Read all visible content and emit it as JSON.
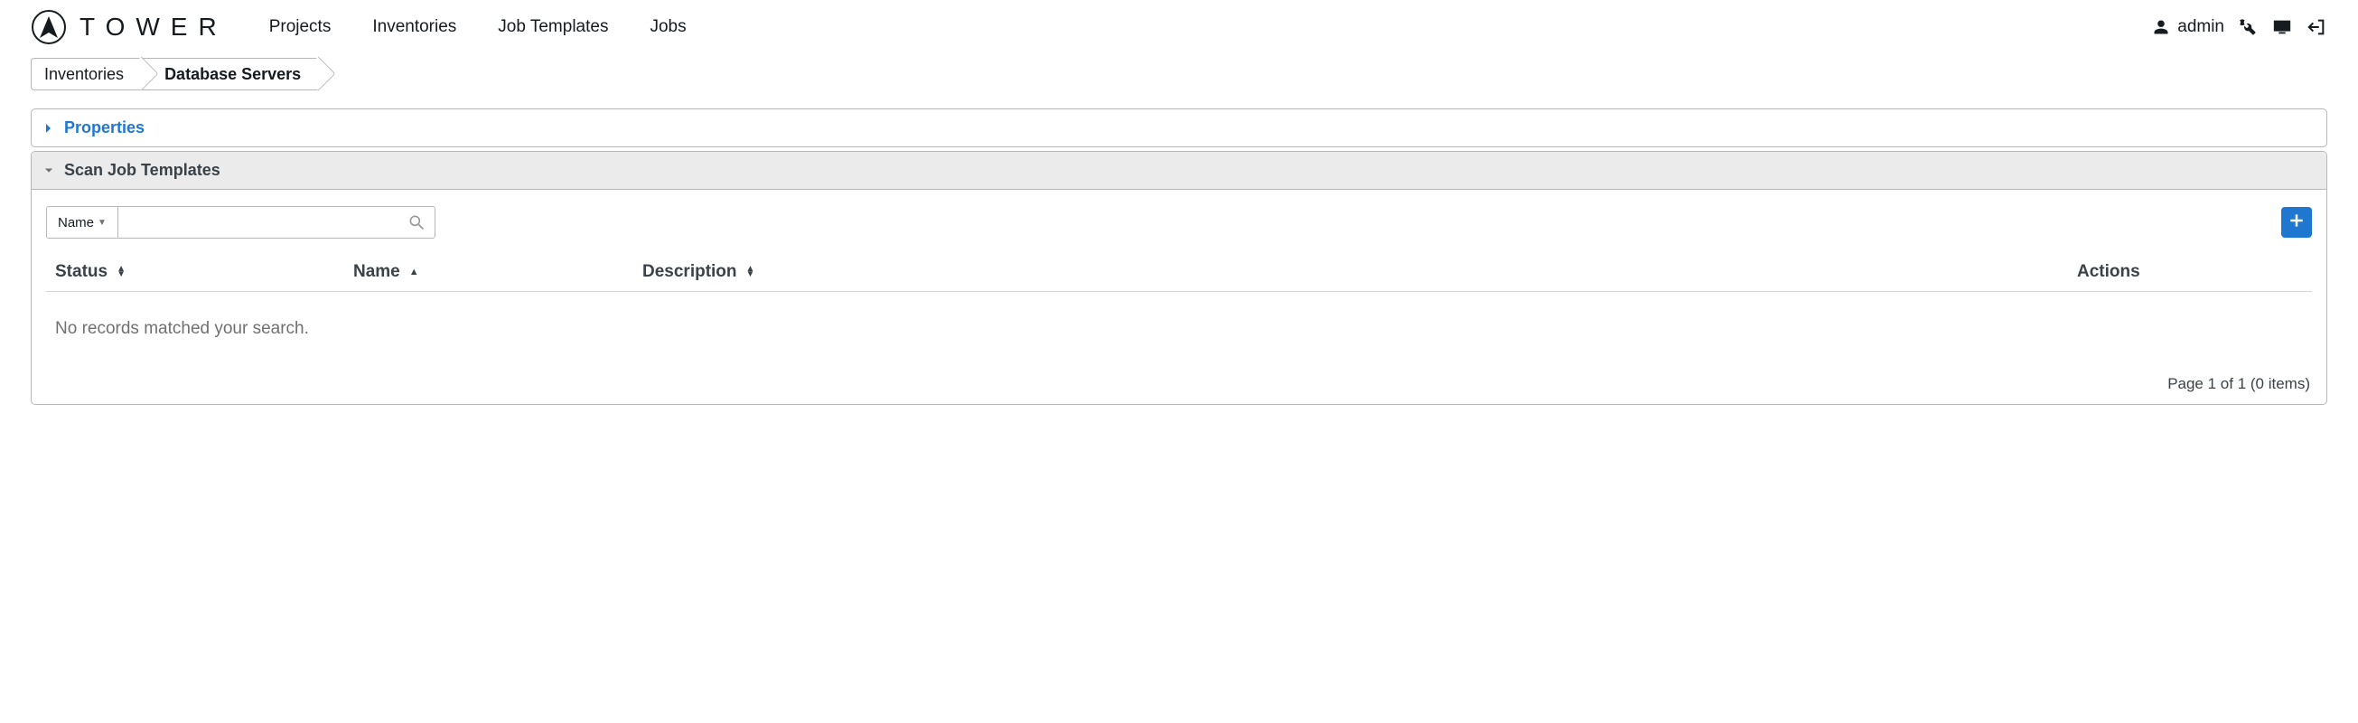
{
  "brand": {
    "name": "TOWER"
  },
  "nav": {
    "items": [
      {
        "label": "Projects"
      },
      {
        "label": "Inventories"
      },
      {
        "label": "Job Templates"
      },
      {
        "label": "Jobs"
      }
    ]
  },
  "user": {
    "name": "admin"
  },
  "breadcrumbs": [
    {
      "label": "Inventories"
    },
    {
      "label": "Database Servers"
    }
  ],
  "panels": {
    "properties": {
      "title": "Properties"
    },
    "scan_jobs": {
      "title": "Scan Job Templates",
      "search_field": "Name",
      "search_value": "",
      "columns": {
        "status": "Status",
        "name": "Name",
        "description": "Description",
        "actions": "Actions"
      },
      "empty": "No records matched your search.",
      "pager": "Page 1 of 1 (0 items)"
    }
  }
}
